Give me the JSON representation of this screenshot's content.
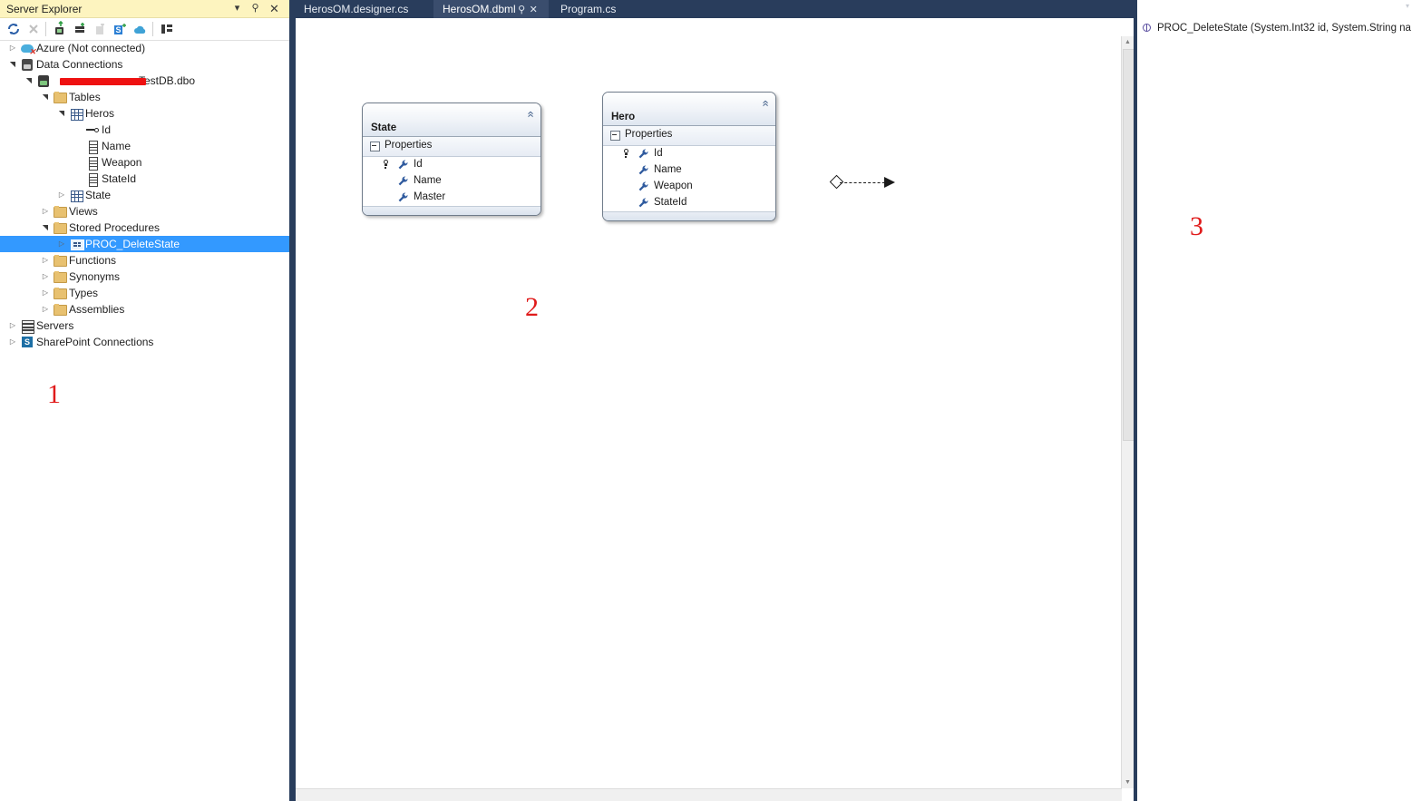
{
  "server_explorer": {
    "title": "Server Explorer",
    "titlebar_buttons": [
      {
        "name": "window-menu-icon",
        "glyph": "▾"
      },
      {
        "name": "pin-icon",
        "glyph": "⚲"
      },
      {
        "name": "close-icon",
        "glyph": "✕"
      }
    ],
    "toolbar": [
      {
        "name": "refresh-icon",
        "title": "Refresh"
      },
      {
        "name": "stop-icon",
        "title": "Stop"
      },
      {
        "name": "connect-to-database-icon",
        "title": "Connect to Database"
      },
      {
        "name": "add-server-icon",
        "title": "Add Server"
      },
      {
        "name": "delete-icon",
        "title": "Delete"
      },
      {
        "name": "sql-server-object-icon",
        "title": "SQL Server"
      },
      {
        "name": "azure-icon",
        "title": "Azure"
      },
      {
        "name": "properties-icon",
        "title": "Properties"
      }
    ],
    "tree": [
      {
        "label": "Azure (Not connected)",
        "indent": 0,
        "arrow": "collapsed",
        "icon": "azure"
      },
      {
        "label": "Data Connections",
        "indent": 0,
        "arrow": "expanded",
        "icon": "db-connections"
      },
      {
        "label": "TestDB.dbo",
        "indent": 1,
        "arrow": "expanded",
        "icon": "database",
        "redacted": true
      },
      {
        "label": "Tables",
        "indent": 2,
        "arrow": "expanded",
        "icon": "folder"
      },
      {
        "label": "Heros",
        "indent": 3,
        "arrow": "expanded",
        "icon": "table"
      },
      {
        "label": "Id",
        "indent": 4,
        "arrow": "none",
        "icon": "key"
      },
      {
        "label": "Name",
        "indent": 4,
        "arrow": "none",
        "icon": "column"
      },
      {
        "label": "Weapon",
        "indent": 4,
        "arrow": "none",
        "icon": "column"
      },
      {
        "label": "StateId",
        "indent": 4,
        "arrow": "none",
        "icon": "column"
      },
      {
        "label": "State",
        "indent": 3,
        "arrow": "collapsed",
        "icon": "table"
      },
      {
        "label": "Views",
        "indent": 2,
        "arrow": "collapsed",
        "icon": "folder"
      },
      {
        "label": "Stored Procedures",
        "indent": 2,
        "arrow": "expanded",
        "icon": "folder"
      },
      {
        "label": "PROC_DeleteState",
        "indent": 3,
        "arrow": "collapsed",
        "icon": "proc",
        "selected": true
      },
      {
        "label": "Functions",
        "indent": 2,
        "arrow": "collapsed",
        "icon": "folder"
      },
      {
        "label": "Synonyms",
        "indent": 2,
        "arrow": "collapsed",
        "icon": "folder"
      },
      {
        "label": "Types",
        "indent": 2,
        "arrow": "collapsed",
        "icon": "folder"
      },
      {
        "label": "Assemblies",
        "indent": 2,
        "arrow": "collapsed",
        "icon": "folder"
      },
      {
        "label": "Servers",
        "indent": 0,
        "arrow": "collapsed",
        "icon": "server"
      },
      {
        "label": "SharePoint Connections",
        "indent": 0,
        "arrow": "collapsed",
        "icon": "sharepoint"
      }
    ]
  },
  "tabs": [
    {
      "label": "HerosOM.designer.cs",
      "active": false
    },
    {
      "label": "HerosOM.dbml",
      "active": true,
      "pin": "⚲",
      "close": "✕"
    },
    {
      "label": "Program.cs",
      "active": false
    }
  ],
  "designer": {
    "entities": [
      {
        "title": "State",
        "collapse_glyph": "«",
        "section_label": "Properties",
        "properties": [
          {
            "name": "Id",
            "is_key": true
          },
          {
            "name": "Name",
            "is_key": false
          },
          {
            "name": "Master",
            "is_key": false
          }
        ]
      },
      {
        "title": "Hero",
        "collapse_glyph": "«",
        "section_label": "Properties",
        "properties": [
          {
            "name": "Id",
            "is_key": true
          },
          {
            "name": "Name",
            "is_key": false
          },
          {
            "name": "Weapon",
            "is_key": false
          },
          {
            "name": "StateId",
            "is_key": false
          }
        ]
      }
    ],
    "association": {
      "source_symbol": "diamond",
      "target_symbol": "arrow",
      "line_style": "dashed"
    }
  },
  "right_panel": {
    "item_label": "PROC_DeleteState (System.Int32 id, System.String na",
    "item_icon": "method-icon",
    "caret": "▾"
  },
  "annotations": [
    {
      "id": "1",
      "text": "1"
    },
    {
      "id": "2",
      "text": "2"
    },
    {
      "id": "3",
      "text": "3"
    }
  ],
  "colors": {
    "titlebar": "#fdf4bf",
    "tabbar": "#293d5c",
    "active_tab": "#3a4d6d",
    "selection": "#3399ff",
    "annotation_red": "#e01b1b"
  }
}
